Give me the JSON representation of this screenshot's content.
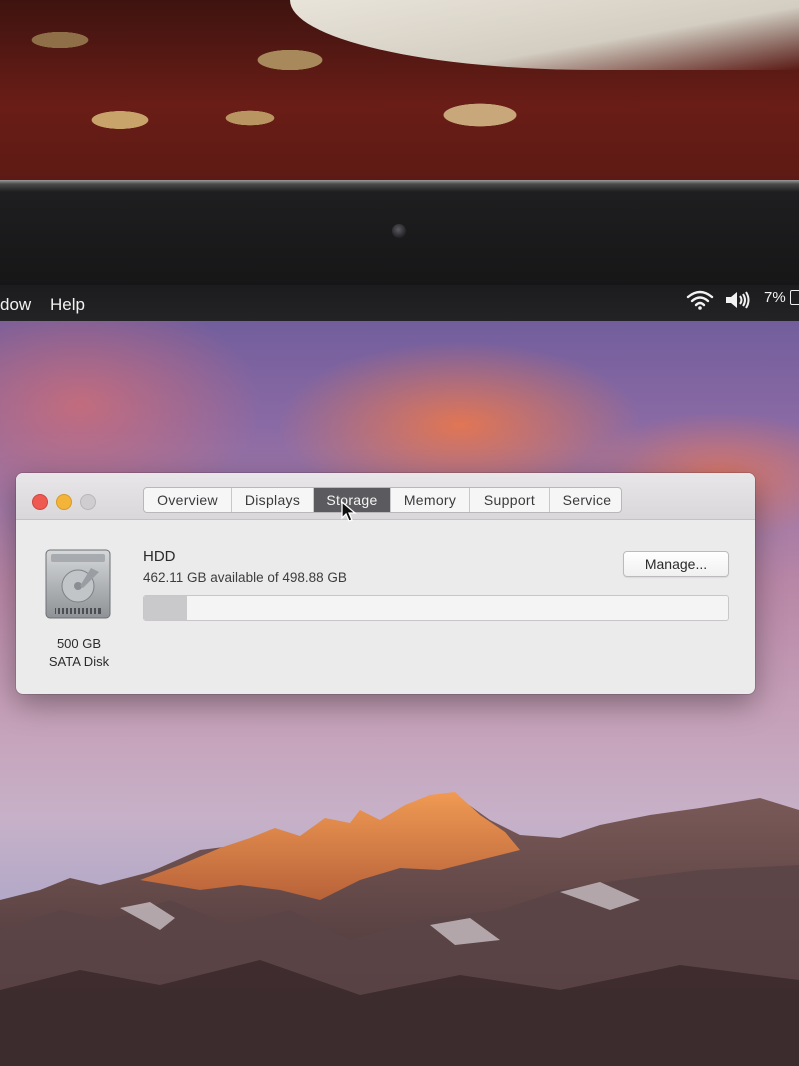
{
  "menubar": {
    "items": [
      "dow",
      "Help"
    ],
    "battery_percent": "7%"
  },
  "window": {
    "tabs": [
      "Overview",
      "Displays",
      "Storage",
      "Memory",
      "Support",
      "Service"
    ],
    "active_tab": "Storage"
  },
  "storage": {
    "disk_name": "HDD",
    "availability": "462.11 GB available of 498.88 GB",
    "capacity_label": "500 GB",
    "disk_type": "SATA Disk",
    "manage_label": "Manage...",
    "used_fraction": 0.074
  },
  "colors": {
    "close": "#ee5a52",
    "minimize": "#f4b43a",
    "zoom_disabled": "#cfcdcf",
    "active_tab": "#5b5a5e",
    "usage_fill": "#c9c8cb"
  },
  "icons": [
    "wifi-icon",
    "volume-icon",
    "battery-icon",
    "hard-disk-icon",
    "pointer-cursor-icon"
  ]
}
